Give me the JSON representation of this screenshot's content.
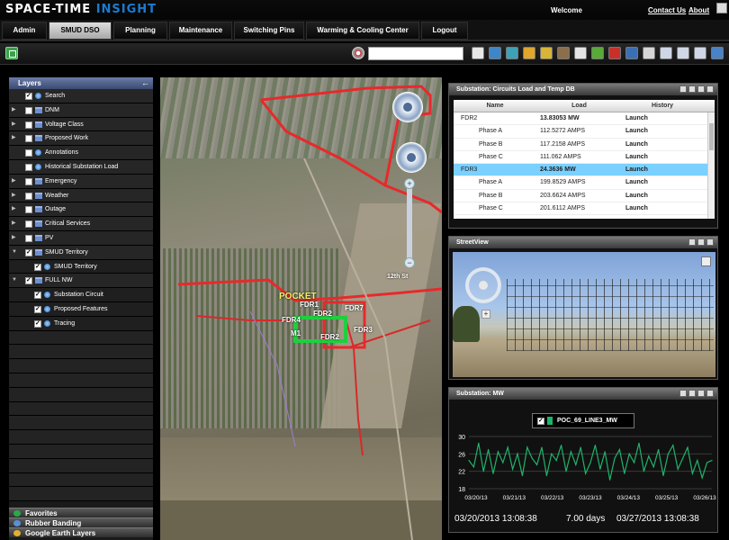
{
  "header": {
    "logo_main": "SPACE-TIME",
    "logo_accent": "INSIGHT",
    "welcome": "Welcome",
    "contact_us": "Contact Us",
    "about": "About"
  },
  "tabs": [
    {
      "label": "Admin",
      "active": false
    },
    {
      "label": "SMUD DSO",
      "active": true
    },
    {
      "label": "Planning",
      "active": false
    },
    {
      "label": "Maintenance",
      "active": false
    },
    {
      "label": "Switching Pins",
      "active": false
    },
    {
      "label": "Warming & Cooling Center",
      "active": false
    },
    {
      "label": "Logout",
      "active": false
    }
  ],
  "toolbar": {
    "search_value": "",
    "buttons": [
      {
        "icon": "document-icon",
        "color": "#e7e7e7"
      },
      {
        "icon": "table-icon",
        "color": "#3f86c9"
      },
      {
        "icon": "ruler-icon",
        "color": "#3fa1b6"
      },
      {
        "icon": "person-icon",
        "color": "#e0a72c"
      },
      {
        "icon": "chart-icon",
        "color": "#d8b437"
      },
      {
        "icon": "map-icon",
        "color": "#8b6f4c"
      },
      {
        "icon": "pointer-icon",
        "color": "#e4e4e4"
      },
      {
        "icon": "tree-icon",
        "color": "#5aaa3a"
      },
      {
        "icon": "alert-icon",
        "color": "#c9302c"
      },
      {
        "icon": "refresh-icon",
        "color": "#3b6fb4"
      },
      {
        "icon": "record-icon",
        "color": "#d6d6d6"
      },
      {
        "icon": "window-icon",
        "color": "#cfd7e6"
      },
      {
        "icon": "window-alt-icon",
        "color": "#cfd7e6"
      },
      {
        "icon": "layers-icon",
        "color": "#cfd7e6"
      },
      {
        "icon": "help-icon",
        "color": "#4a82c6"
      }
    ]
  },
  "layers": {
    "title": "Layers",
    "items": [
      {
        "label": "Search",
        "checked": true,
        "expandable": false,
        "icon": "globe",
        "indent": 0
      },
      {
        "label": "DNM",
        "checked": false,
        "expandable": true,
        "icon": "folder",
        "indent": 0
      },
      {
        "label": "Voltage Class",
        "checked": false,
        "expandable": true,
        "icon": "folder",
        "indent": 0
      },
      {
        "label": "Proposed Work",
        "checked": false,
        "expandable": true,
        "icon": "folder",
        "indent": 0
      },
      {
        "label": "Annotations",
        "checked": false,
        "expandable": false,
        "icon": "globe",
        "indent": 0
      },
      {
        "label": "Historical Substation Load",
        "checked": false,
        "expandable": false,
        "icon": "globe",
        "indent": 0
      },
      {
        "label": "Emergency",
        "checked": false,
        "expandable": true,
        "icon": "folder",
        "indent": 0
      },
      {
        "label": "Weather",
        "checked": false,
        "expandable": true,
        "icon": "folder",
        "indent": 0
      },
      {
        "label": "Outage",
        "checked": false,
        "expandable": true,
        "icon": "folder",
        "indent": 0
      },
      {
        "label": "Critical Services",
        "checked": false,
        "expandable": true,
        "icon": "folder",
        "indent": 0
      },
      {
        "label": "PV",
        "checked": false,
        "expandable": true,
        "icon": "folder",
        "indent": 0
      },
      {
        "label": "SMUD Territory",
        "checked": true,
        "expandable": true,
        "icon": "folder",
        "indent": 0,
        "expanded": true
      },
      {
        "label": "SMUD Territory",
        "checked": true,
        "expandable": false,
        "icon": "globe",
        "indent": 1
      },
      {
        "label": "FULL NW",
        "checked": true,
        "expandable": true,
        "icon": "folder",
        "indent": 0,
        "expanded": true
      },
      {
        "label": "Substation Circuit",
        "checked": true,
        "expandable": false,
        "icon": "globe",
        "indent": 1
      },
      {
        "label": "Proposed Features",
        "checked": true,
        "expandable": false,
        "icon": "globe",
        "indent": 1
      },
      {
        "label": "Tracing",
        "checked": true,
        "expandable": false,
        "icon": "globe",
        "indent": 1
      }
    ],
    "footer": [
      {
        "label": "Favorites",
        "color": "#2aa84a"
      },
      {
        "label": "Rubber Banding",
        "color": "#5a8fd6"
      },
      {
        "label": "Google Earth Layers",
        "color": "#e0b030"
      }
    ]
  },
  "map": {
    "pocket_label": "POCKET",
    "feeder_labels": [
      "FDR1",
      "FDR2",
      "FDR7",
      "FDR4",
      "FDR3",
      "FDR2",
      "M1"
    ],
    "road_label": "12th St"
  },
  "circuits_panel": {
    "title": "Substation: Circuits Load and Temp DB",
    "columns": [
      "Name",
      "Load",
      "History"
    ],
    "rows": [
      {
        "name": "FDR2",
        "load": "13.83053 MW",
        "history": "Launch",
        "bold": true,
        "selected": false,
        "indent": false
      },
      {
        "name": "Phase A",
        "load": "112.5272 AMPS",
        "history": "Launch",
        "bold": false,
        "selected": false,
        "indent": true
      },
      {
        "name": "Phase B",
        "load": "117.2158 AMPS",
        "history": "Launch",
        "bold": false,
        "selected": false,
        "indent": true
      },
      {
        "name": "Phase C",
        "load": "111.062 AMPS",
        "history": "Launch",
        "bold": false,
        "selected": false,
        "indent": true
      },
      {
        "name": "FDR3",
        "load": "24.3636 MW",
        "history": "Launch",
        "bold": true,
        "selected": true,
        "indent": false
      },
      {
        "name": "Phase A",
        "load": "199.8529 AMPS",
        "history": "Launch",
        "bold": false,
        "selected": false,
        "indent": true
      },
      {
        "name": "Phase B",
        "load": "203.6624 AMPS",
        "history": "Launch",
        "bold": false,
        "selected": false,
        "indent": true
      },
      {
        "name": "Phase C",
        "load": "201.6112 AMPS",
        "history": "Launch",
        "bold": false,
        "selected": false,
        "indent": true
      }
    ]
  },
  "streetview_panel": {
    "title": "StreetView"
  },
  "mw_panel": {
    "title": "Substation: MW",
    "legend_label": "POC_69_LINE3_MW",
    "range_start": "03/20/2013 13:08:38",
    "range_span": "7.00 days",
    "range_end": "03/27/2013 13:08:38"
  },
  "chart_data": {
    "type": "line",
    "title": "",
    "xlabel": "",
    "ylabel": "",
    "ylim": [
      18,
      30
    ],
    "yticks": [
      18,
      22,
      26,
      30
    ],
    "xticks": [
      "03/20/13",
      "03/21/13",
      "03/22/13",
      "03/23/13",
      "03/24/13",
      "03/25/13",
      "03/26/13"
    ],
    "grid": true,
    "series": [
      {
        "name": "POC_69_LINE3_MW",
        "color": "#1fb36a",
        "values": [
          24.5,
          23,
          28.5,
          22,
          27,
          21.5,
          26.5,
          24,
          27.5,
          22.5,
          26,
          21,
          27.5,
          25,
          23.5,
          27.5,
          21,
          26,
          24.5,
          28,
          22,
          26.5,
          23.5,
          27.5,
          21.5,
          24,
          28,
          22.5,
          26.5,
          20,
          25,
          27,
          21.5,
          26,
          24,
          28.5,
          22,
          25.5,
          23,
          27,
          21,
          26,
          28,
          22.5,
          25,
          27.5,
          21.5,
          24.5,
          20.5,
          24,
          24.5
        ]
      }
    ]
  }
}
